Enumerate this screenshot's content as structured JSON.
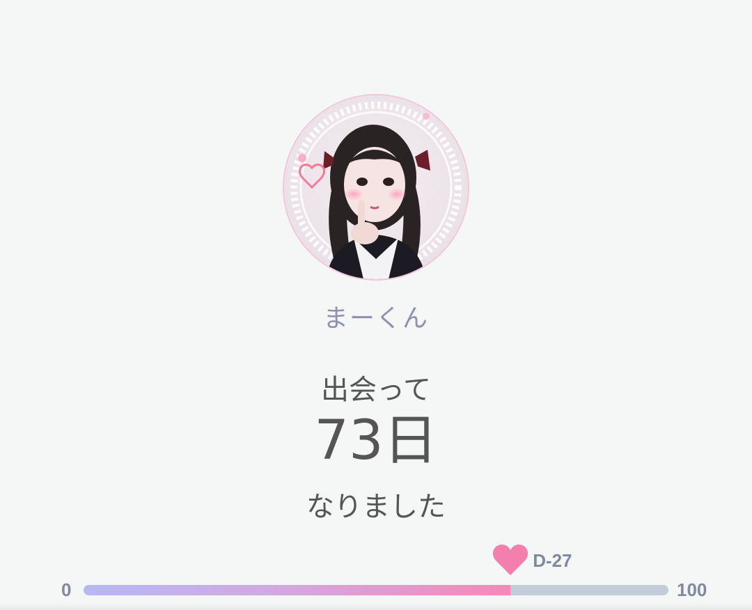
{
  "profile": {
    "name": "まーくん"
  },
  "counter": {
    "prefix": "出会って",
    "days": "73日",
    "suffix": "なりました"
  },
  "progress": {
    "min_label": "0",
    "max_label": "100",
    "value": 73,
    "max": 100,
    "marker_label": "D-27",
    "marker_icon": "heart-icon"
  },
  "colors": {
    "marker_heart": "#f27fae",
    "bar_start": "#b6b8f4",
    "bar_end": "#f38ab9",
    "bar_track": "#c2cddc"
  }
}
